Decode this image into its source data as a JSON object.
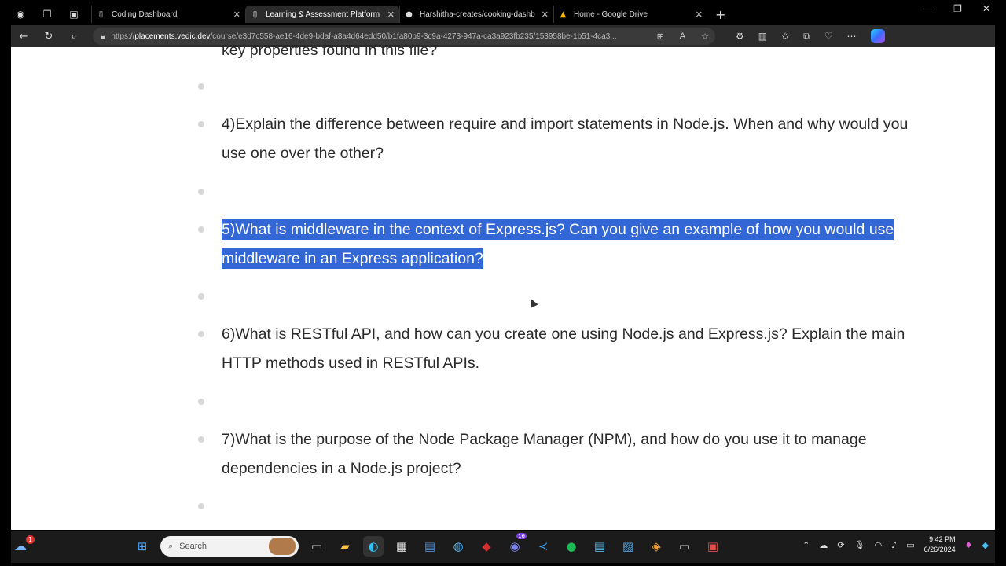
{
  "tabs": [
    {
      "label": "Coding Dashboard",
      "icon": "page-icon",
      "active": false
    },
    {
      "label": "Learning & Assessment Platform",
      "icon": "page-icon",
      "active": true
    },
    {
      "label": "Harshitha-creates/cooking-dashb",
      "icon": "github-icon",
      "active": false
    },
    {
      "label": "Home - Google Drive",
      "icon": "google-drive-icon",
      "active": false
    }
  ],
  "address": {
    "prefix": "https://",
    "host": "placements.vedic.dev",
    "path": "/course/e3d7c558-ae16-4de9-bdaf-a8a4d64edd50/b1fa80b9-3c9a-4273-947a-ca3a923fb235/153958be-1b51-4ca3..."
  },
  "questions": [
    {
      "text": "key properties found in this file?",
      "highlighted": false
    },
    {
      "text": "4)Explain the difference between require and import statements in Node.js. When and why would you use one over the other?",
      "highlighted": false
    },
    {
      "text": "5)What is middleware in the context of Express.js? Can you give an example of how you would use middleware in an Express application?",
      "highlighted": true
    },
    {
      "text": "6)What is RESTful API, and how can you create one using Node.js and Express.js? Explain the main HTTP methods used in RESTful APIs.",
      "highlighted": false
    },
    {
      "text": "7)What is the purpose of the Node Package Manager (NPM), and how do you use it to manage dependencies in a Node.js project?",
      "highlighted": false
    }
  ],
  "taskbar": {
    "search_placeholder": "Search",
    "weather_badge": "1",
    "teams_badge": "16",
    "time": "9:42 PM",
    "date": "6/26/2024"
  },
  "colors": {
    "highlight": "#3367d6",
    "page_bg": "#ffffff",
    "chrome_bg": "#2b2b2b"
  }
}
